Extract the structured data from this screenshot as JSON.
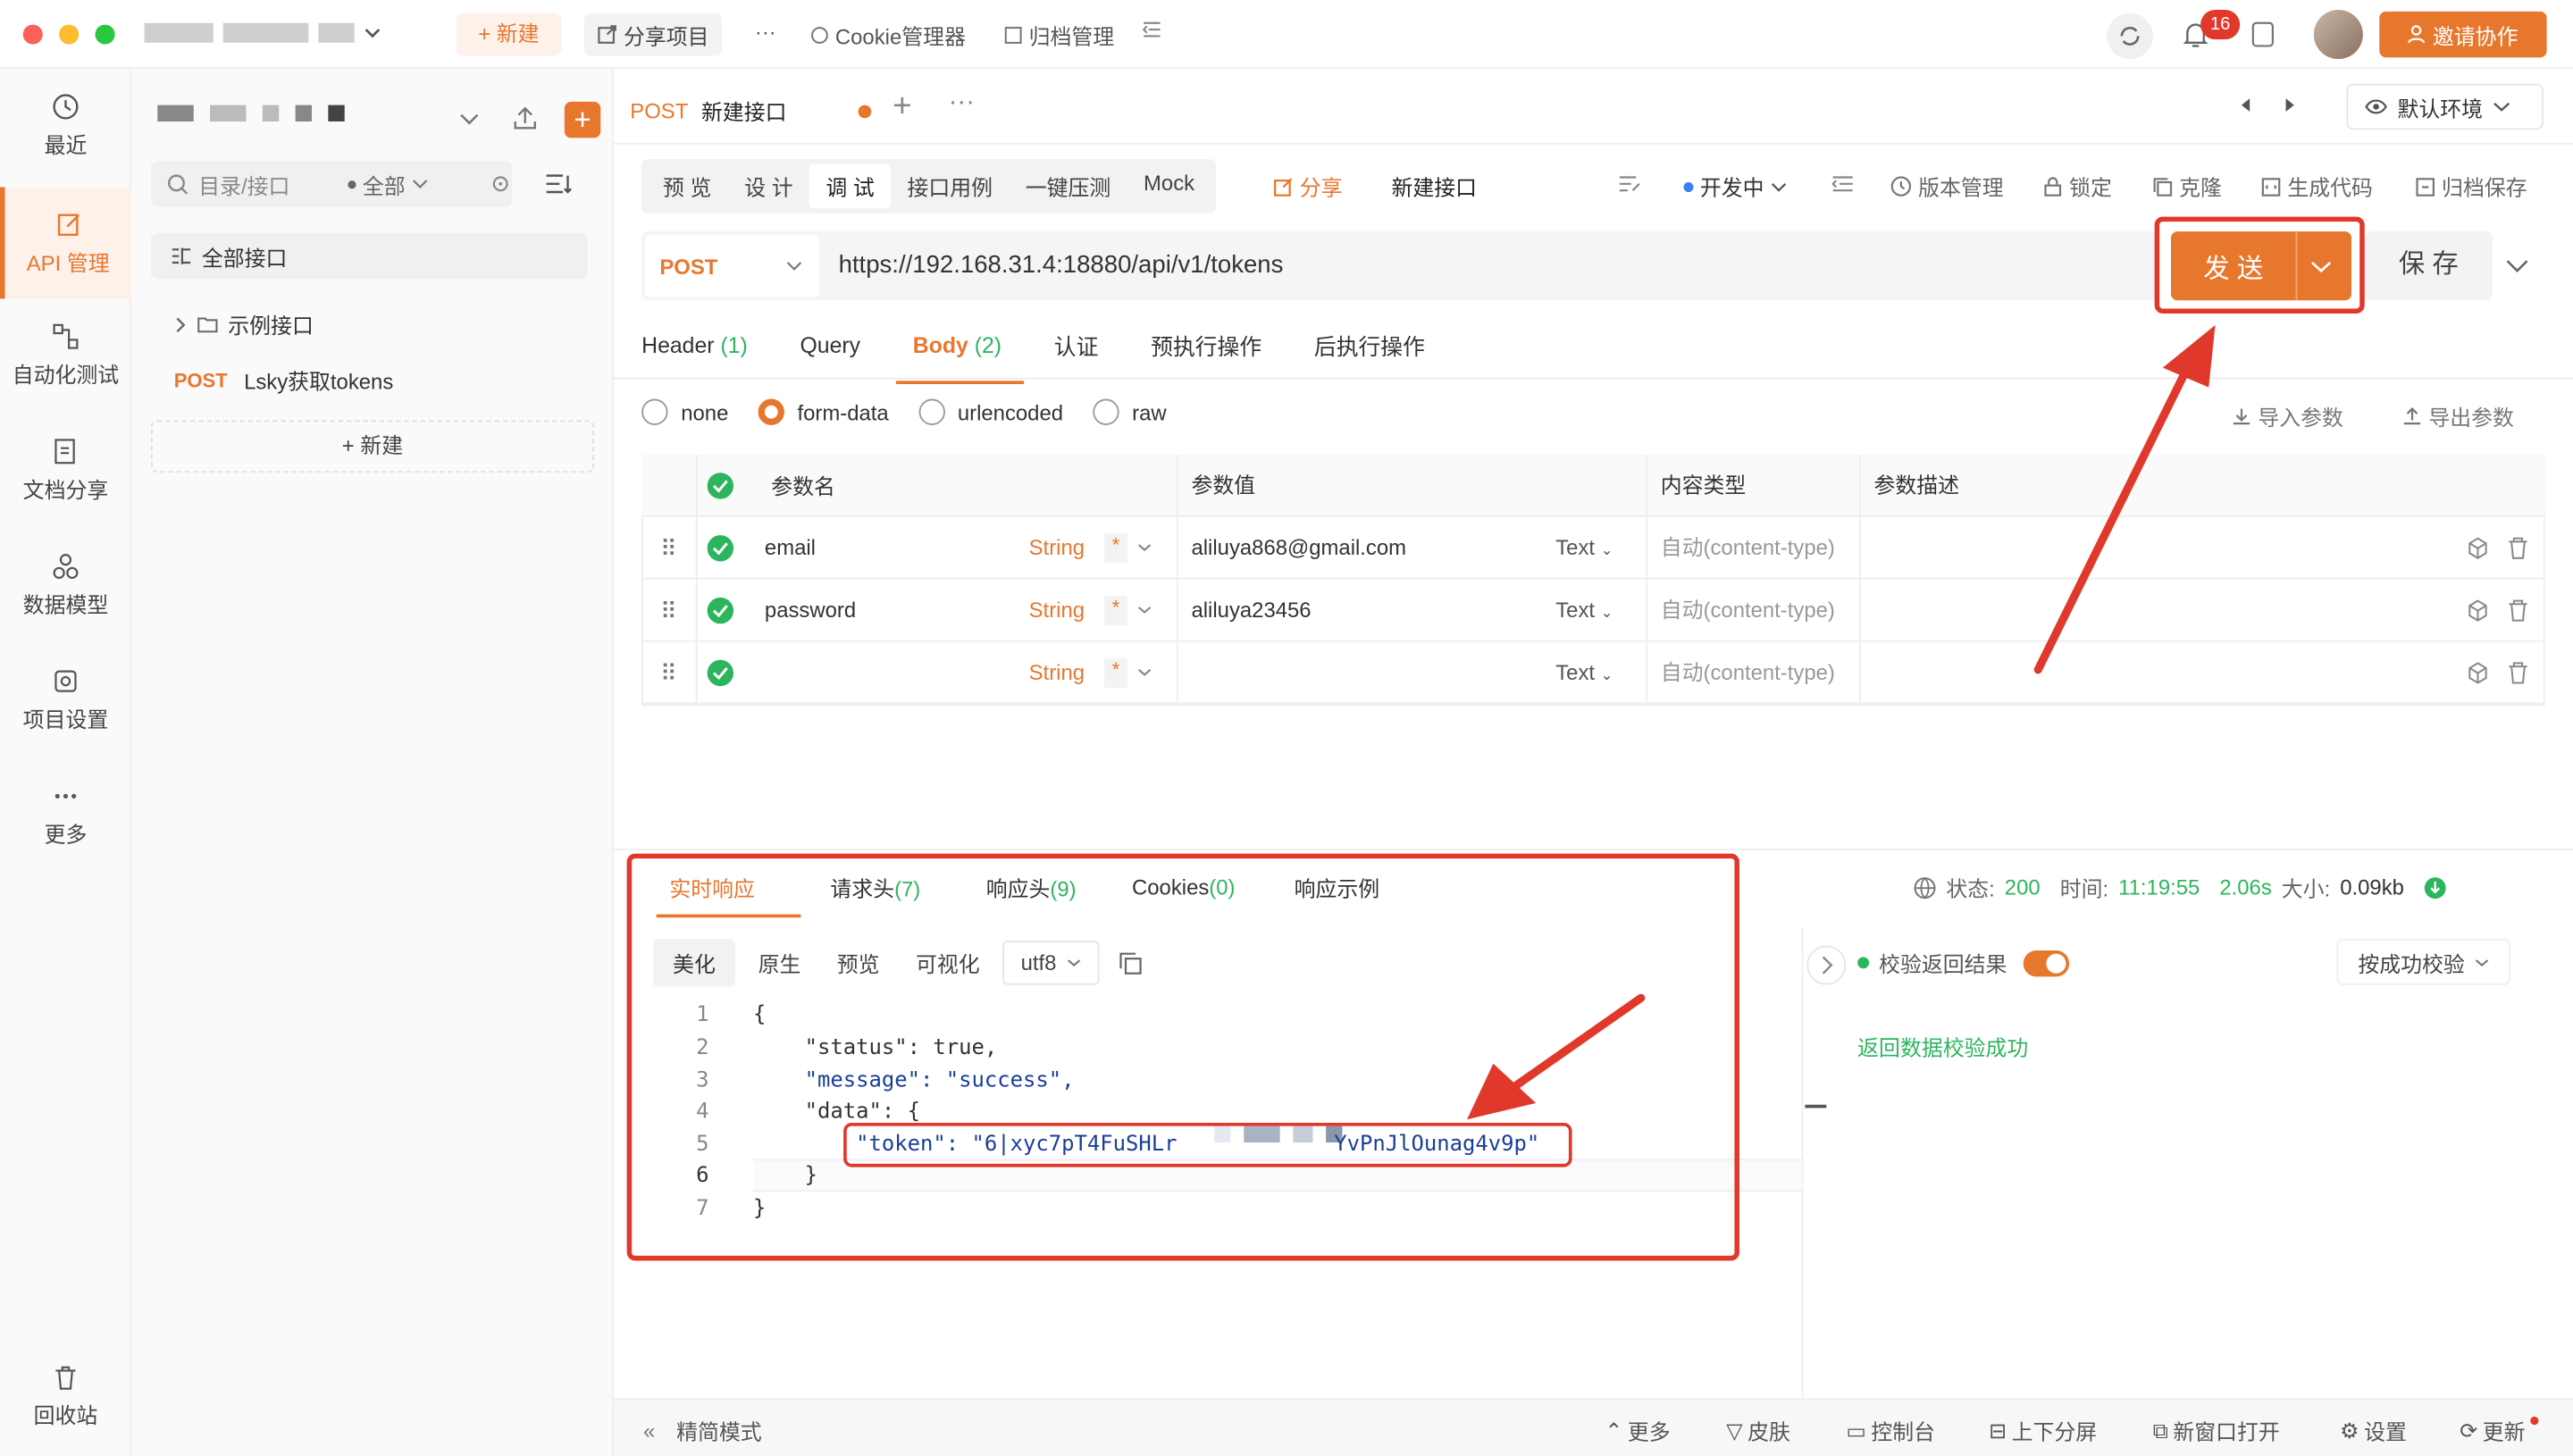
{
  "titlebar": {
    "new_label": "+ 新建",
    "share_project": "分享项目",
    "more": "···",
    "cookie_manager": "Cookie管理器",
    "archive_manager": "归档管理",
    "notif_count": "16",
    "invite": "邀请协作"
  },
  "leftnav": {
    "items": [
      {
        "label": "最近"
      },
      {
        "label": "API 管理"
      },
      {
        "label": "自动化测试"
      },
      {
        "label": "文档分享"
      },
      {
        "label": "数据模型"
      },
      {
        "label": "项目设置"
      },
      {
        "label": "更多"
      }
    ],
    "recycle": "回收站"
  },
  "tree": {
    "search_placeholder": "目录/接口",
    "filter": "全部",
    "all_label": "全部接口",
    "folder": "示例接口",
    "api_method": "POST",
    "api_name": "Lsky获取tokens",
    "new_btn": "+ 新建"
  },
  "tabs": {
    "method": "POST",
    "name": "新建接口",
    "env": "默认环境"
  },
  "toolbar": {
    "modes": [
      "预 览",
      "设 计",
      "调 试",
      "接口用例",
      "一键压测",
      "Mock"
    ],
    "share": "分享",
    "api_name": "新建接口",
    "status": "开发中",
    "version": "版本管理",
    "lock": "锁定",
    "clone": "克隆",
    "gen_code": "生成代码",
    "archive": "归档保存"
  },
  "request": {
    "method": "POST",
    "url": "https://192.168.31.4:18880/api/v1/tokens",
    "send": "发 送",
    "save": "保 存"
  },
  "req_tabs": [
    {
      "label": "Header",
      "count": "(1)"
    },
    {
      "label": "Query",
      "count": ""
    },
    {
      "label": "Body",
      "count": "(2)"
    },
    {
      "label": "认证",
      "count": ""
    },
    {
      "label": "预执行操作",
      "count": ""
    },
    {
      "label": "后执行操作",
      "count": ""
    }
  ],
  "body_types": [
    "none",
    "form-data",
    "urlencoded",
    "raw"
  ],
  "import_params": "导入参数",
  "export_params": "导出参数",
  "table": {
    "headers": [
      "参数名",
      "参数值",
      "内容类型",
      "参数描述"
    ],
    "rows": [
      {
        "name": "email",
        "type": "String",
        "value": "aliluya868@gmail.com",
        "vtype": "Text",
        "content_type": "自动(content-type)"
      },
      {
        "name": "password",
        "type": "String",
        "value": "aliluya23456",
        "vtype": "Text",
        "content_type": "自动(content-type)"
      },
      {
        "name": "",
        "type": "String",
        "value": "",
        "vtype": "Text",
        "content_type": "自动(content-type)"
      }
    ],
    "required_mark": "*"
  },
  "response": {
    "tabs": [
      {
        "label": "实时响应",
        "count": ""
      },
      {
        "label": "请求头",
        "count": "(7)"
      },
      {
        "label": "响应头",
        "count": "(9)"
      },
      {
        "label": "Cookies",
        "count": "(0)"
      },
      {
        "label": "响应示例",
        "count": ""
      }
    ],
    "views": [
      "美化",
      "原生",
      "预览",
      "可视化"
    ],
    "encoding": "utf8",
    "status_label": "状态:",
    "status": "200",
    "time_label": "时间:",
    "time": "11:19:55",
    "duration": "2.06s",
    "size_label": "大小:",
    "size": "0.09kb",
    "verify_label": "校验返回结果",
    "verify_mode": "按成功校验",
    "verify_result": "返回数据校验成功",
    "code_lines": [
      "{",
      "    \"status\": true,",
      "    \"message\": \"success\",",
      "    \"data\": {",
      "        \"token\": \"6|xyc7pT4FuSHLr",
      "    }",
      "}"
    ],
    "token_tail": "YvPnJlOunag4v9p\""
  },
  "footer": {
    "simple_mode": "精简模式",
    "items": [
      "更多",
      "皮肤",
      "控制台",
      "上下分屏",
      "新窗口打开",
      "设置",
      "更新"
    ]
  },
  "colors": {
    "accent": "#e8772e",
    "highlight": "#e0392b",
    "success": "#2db55d"
  }
}
